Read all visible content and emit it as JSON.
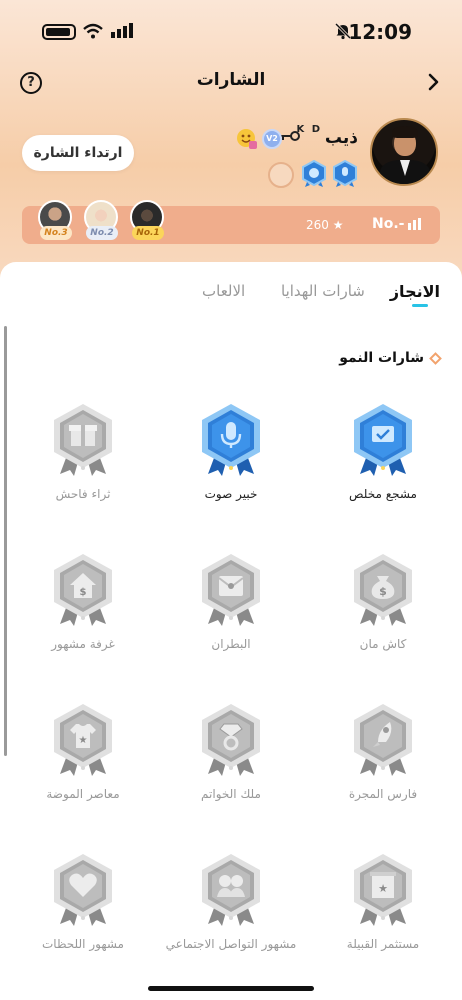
{
  "status": {
    "time": "12:09"
  },
  "header": {
    "title": "الشارات",
    "help": "?"
  },
  "profile": {
    "name": "ذيب",
    "tag": "K D",
    "vip": "V2",
    "equip_button": "ارتداء الشارة"
  },
  "ranking": {
    "top": [
      {
        "tag": "No.3",
        "color": "#e49a3b"
      },
      {
        "tag": "No.2",
        "color": "#9aa7c2"
      },
      {
        "tag": "No.1",
        "color": "#e0a21a"
      }
    ],
    "score": "260",
    "my_rank": "No.-"
  },
  "tabs": [
    {
      "label": "الانجاز",
      "active": true
    },
    {
      "label": "شارات الهدايا",
      "active": false
    },
    {
      "label": "الالعاب",
      "active": false
    }
  ],
  "section_title": "شارات النمو",
  "badges": [
    {
      "name": "مشجع مخلص",
      "icon": "screen-check-icon",
      "unlocked": true
    },
    {
      "name": "خبير صوت",
      "icon": "microphone-icon",
      "unlocked": true
    },
    {
      "name": "ثراء فاحش",
      "icon": "gift-icon",
      "unlocked": false
    },
    {
      "name": "كاش مان",
      "icon": "money-bag-icon",
      "unlocked": false
    },
    {
      "name": "البطران",
      "icon": "envelope-icon",
      "unlocked": false
    },
    {
      "name": "غرفة مشهور",
      "icon": "house-dollar-icon",
      "unlocked": false
    },
    {
      "name": "فارس المجرة",
      "icon": "rocket-icon",
      "unlocked": false
    },
    {
      "name": "ملك الخواتم",
      "icon": "diamond-ring-icon",
      "unlocked": false
    },
    {
      "name": "معاصر الموضة",
      "icon": "tshirt-icon",
      "unlocked": false
    },
    {
      "name": "مستثمر القبيلة",
      "icon": "flag-star-icon",
      "unlocked": false
    },
    {
      "name": "مشهور التواصل الاجتماعي",
      "icon": "people-icon",
      "unlocked": false
    },
    {
      "name": "مشهور اللحظات",
      "icon": "heart-icon",
      "unlocked": false
    }
  ],
  "colors": {
    "accent": "#29c3e6",
    "unlocked_badge": "#2f7fd8",
    "locked_badge": "#a9a9a9"
  }
}
